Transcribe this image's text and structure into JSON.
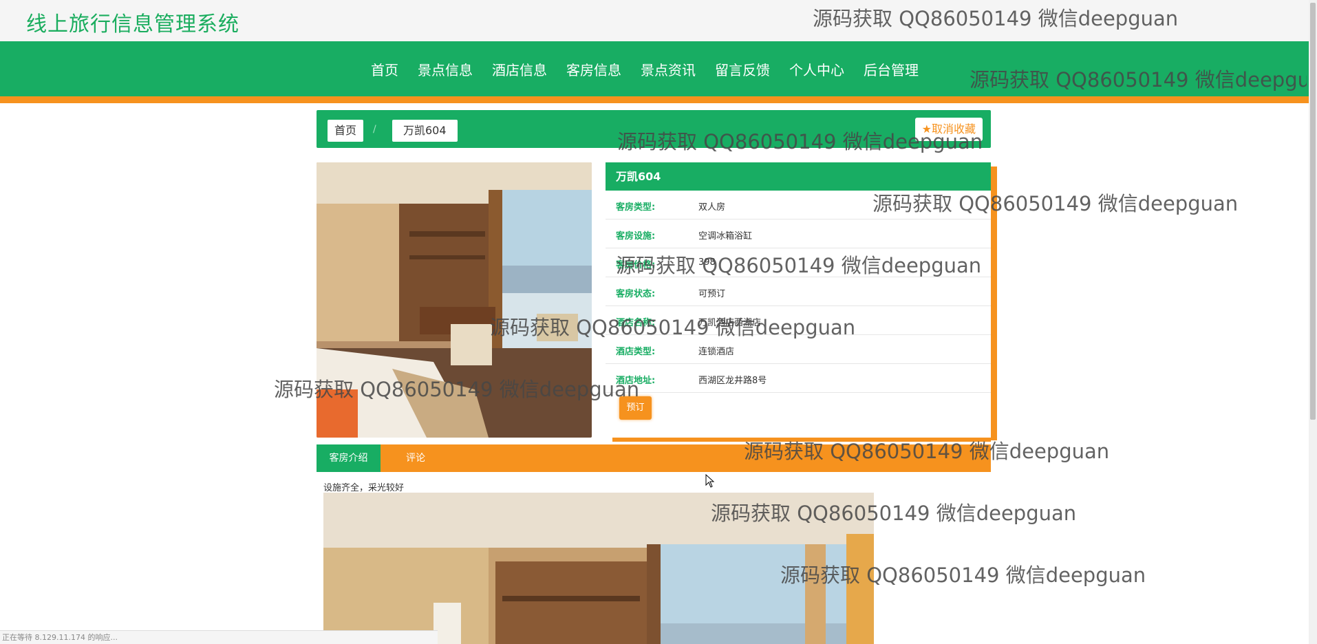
{
  "site": {
    "title": "线上旅行信息管理系统"
  },
  "nav": {
    "items": [
      "首页",
      "景点信息",
      "酒店信息",
      "客房信息",
      "景点资讯",
      "留言反馈",
      "个人中心",
      "后台管理"
    ]
  },
  "breadcrumb": {
    "home": "首页",
    "separator": "/",
    "current": "万凯604"
  },
  "favorite_button": "取消收藏",
  "room": {
    "name": "万凯604",
    "fields": [
      {
        "label": "客房类型:",
        "value": "双人房"
      },
      {
        "label": "客房设施:",
        "value": "空调冰箱浴缸"
      },
      {
        "label": "客房价格:",
        "value": "398"
      },
      {
        "label": "客房状态:",
        "value": "可预订"
      },
      {
        "label": "酒店名称:",
        "value": "万凯酒店西湖店"
      },
      {
        "label": "酒店类型:",
        "value": "连锁酒店"
      },
      {
        "label": "酒店地址:",
        "value": "西湖区龙井路8号"
      }
    ],
    "book_button": "预订"
  },
  "tabs": [
    "客房介绍",
    "评论"
  ],
  "description": "设施齐全，采光较好",
  "status_bar": "正在等待 8.129.11.174 的响应...",
  "watermark": "源码获取 QQ86050149 微信deepguan",
  "colors": {
    "primary": "#18ad63",
    "accent": "#f6921e"
  }
}
